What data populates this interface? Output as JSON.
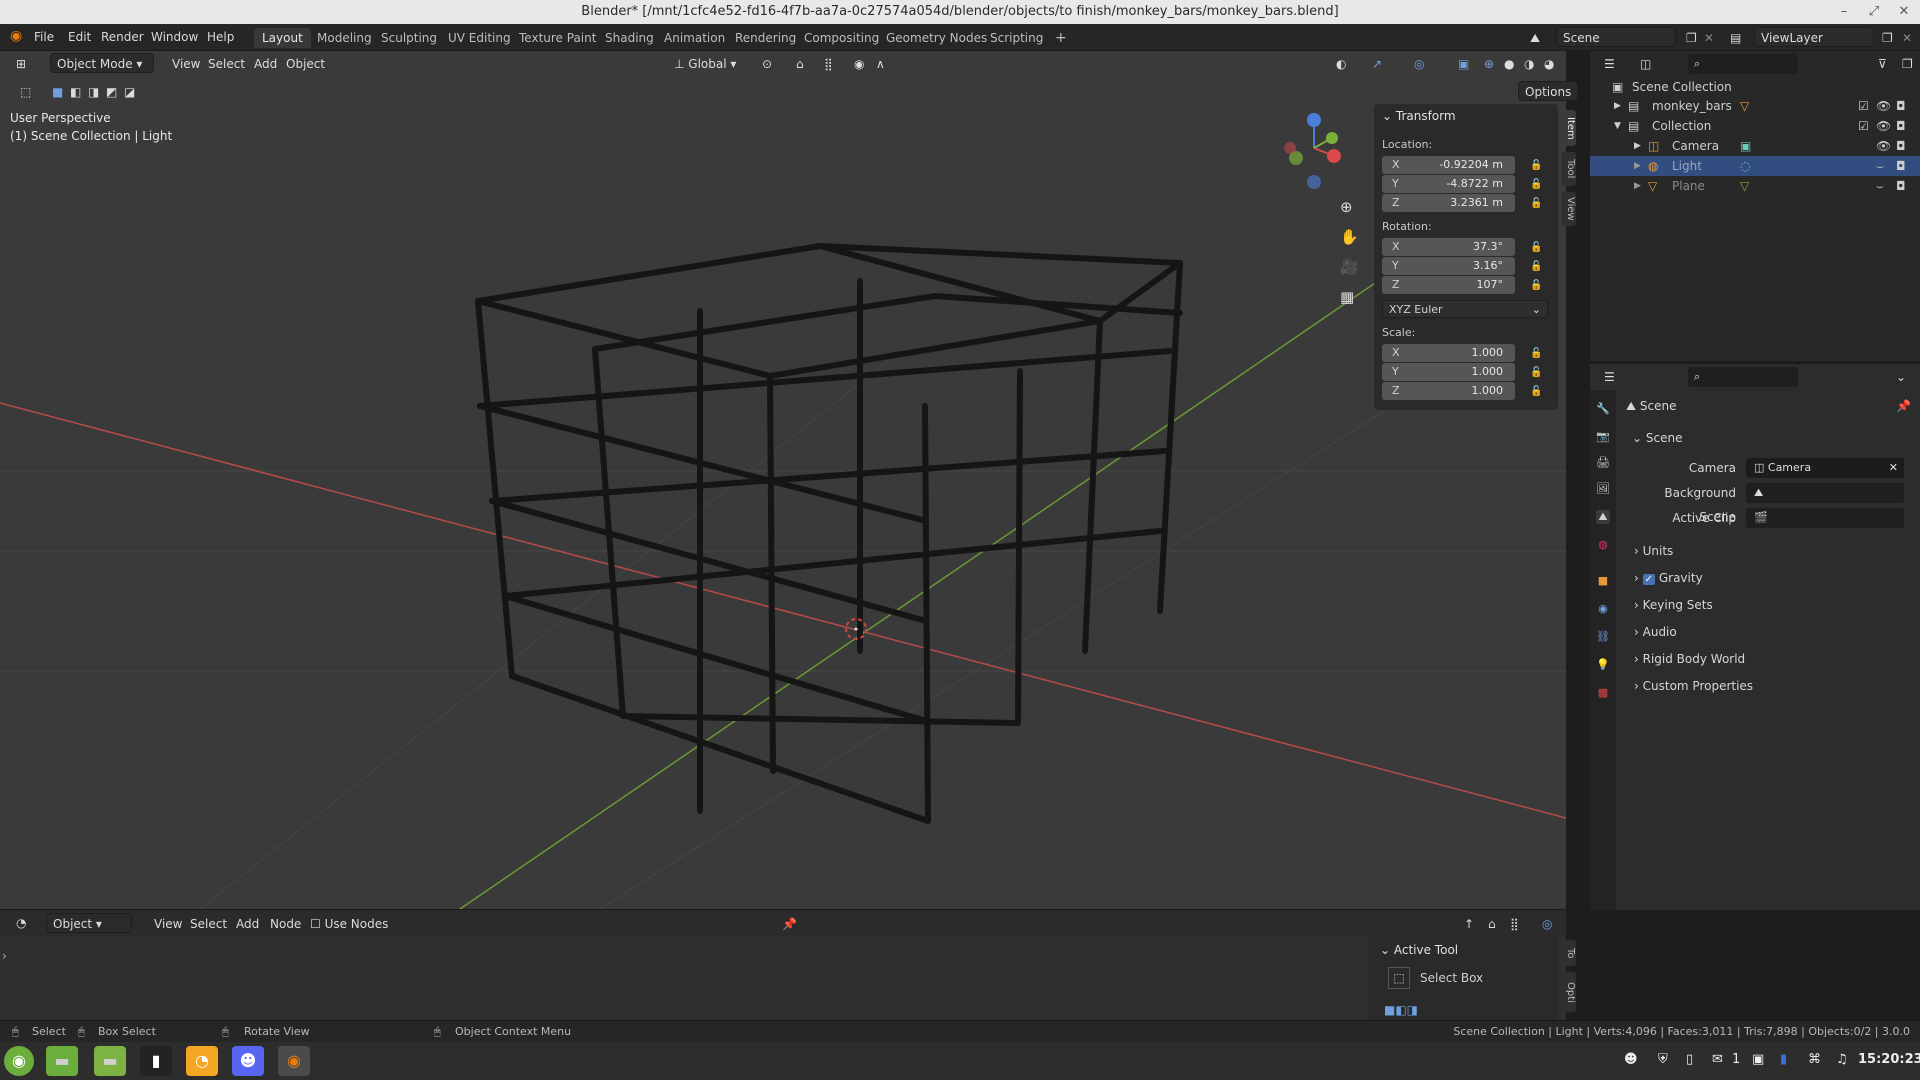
{
  "window": {
    "title": "Blender* [/mnt/1cfc4e52-fd16-4f7b-aa7a-0c27574a054d/blender/objects/to finish/monkey_bars/monkey_bars.blend]",
    "min": "–",
    "max": "⤢",
    "close": "✕"
  },
  "menu": [
    "File",
    "Edit",
    "Render",
    "Window",
    "Help"
  ],
  "workspaces": [
    "Layout",
    "Modeling",
    "Sculpting",
    "UV Editing",
    "Texture Paint",
    "Shading",
    "Animation",
    "Rendering",
    "Compositing",
    "Geometry Nodes",
    "Scripting",
    "+"
  ],
  "scene_field": "Scene",
  "viewlayer_field": "ViewLayer",
  "viewport": {
    "mode": "Object Mode",
    "menus": [
      "View",
      "Select",
      "Add",
      "Object"
    ],
    "orientation": "Global",
    "options": "Options",
    "perspective": "User Perspective",
    "context": "(1) Scene Collection | Light"
  },
  "transform": {
    "header": "Transform",
    "location_label": "Location:",
    "location": [
      {
        "ax": "X",
        "v": "-0.92204 m"
      },
      {
        "ax": "Y",
        "v": "-4.8722 m"
      },
      {
        "ax": "Z",
        "v": "3.2361 m"
      }
    ],
    "rotation_label": "Rotation:",
    "rotation": [
      {
        "ax": "X",
        "v": "37.3°"
      },
      {
        "ax": "Y",
        "v": "3.16°"
      },
      {
        "ax": "Z",
        "v": "107°"
      }
    ],
    "rotation_mode": "XYZ Euler",
    "scale_label": "Scale:",
    "scale": [
      {
        "ax": "X",
        "v": "1.000"
      },
      {
        "ax": "Y",
        "v": "1.000"
      },
      {
        "ax": "Z",
        "v": "1.000"
      }
    ]
  },
  "side_tabs": [
    "Item",
    "Tool",
    "View"
  ],
  "outliner": {
    "root": "Scene Collection",
    "items": [
      "monkey_bars",
      "Collection",
      "Camera",
      "Light",
      "Plane"
    ]
  },
  "properties": {
    "title": "Scene",
    "section": "Scene",
    "camera_label": "Camera",
    "camera_value": "Camera",
    "bg_scene_label": "Background Scene",
    "active_clip_label": "Active Clip",
    "panels": [
      "Units",
      "Gravity",
      "Keying Sets",
      "Audio",
      "Rigid Body World",
      "Custom Properties"
    ]
  },
  "node_editor": {
    "type": "Object",
    "menus": [
      "View",
      "Select",
      "Add",
      "Node"
    ],
    "use_nodes": "Use Nodes"
  },
  "active_tool": {
    "header": "Active Tool",
    "tool": "Select Box",
    "tabs": [
      "To",
      "Opti"
    ]
  },
  "status": {
    "select": "Select",
    "box_select": "Box Select",
    "rotate": "Rotate View",
    "context_menu": "Object Context Menu",
    "stats": "Scene Collection | Light | Verts:4,096 | Faces:3,011 | Tris:7,898 | Objects:0/2 | 3.0.0"
  },
  "taskbar": {
    "workspace_num": "1",
    "time": "15:20:23"
  },
  "colors": {
    "accent": "#4772b3",
    "x_axis": "#d94a4a",
    "y_axis": "#7ab03a",
    "z_axis": "#4a7fd9"
  }
}
